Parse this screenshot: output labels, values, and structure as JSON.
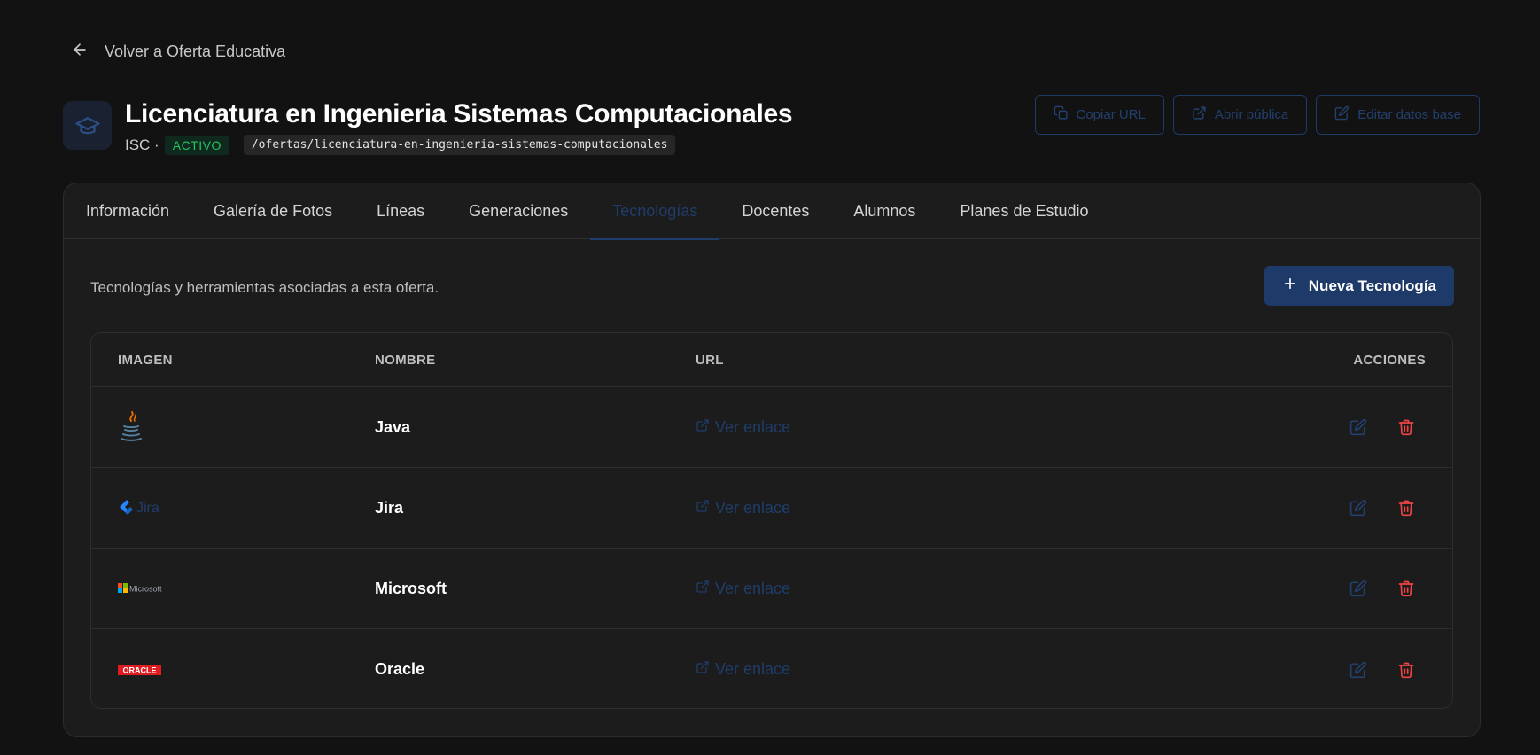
{
  "back": {
    "label": "Volver a Oferta Educativa"
  },
  "header": {
    "title": "Licenciatura en Ingenieria Sistemas Computacionales",
    "code": "ISC ·",
    "status": "ACTIVO",
    "slug": "/ofertas/licenciatura-en-ingenieria-sistemas-computacionales"
  },
  "actions": {
    "copy_url": "Copiar URL",
    "open_public": "Abrir pública",
    "edit_base": "Editar datos base"
  },
  "tabs": [
    {
      "label": "Información"
    },
    {
      "label": "Galería de Fotos"
    },
    {
      "label": "Líneas"
    },
    {
      "label": "Generaciones"
    },
    {
      "label": "Tecnologías",
      "active": true
    },
    {
      "label": "Docentes"
    },
    {
      "label": "Alumnos"
    },
    {
      "label": "Planes de Estudio"
    }
  ],
  "section": {
    "description": "Tecnologías y herramientas asociadas a esta oferta.",
    "new_button": "Nueva Tecnología"
  },
  "table": {
    "headers": {
      "image": "IMAGEN",
      "name": "NOMBRE",
      "url": "URL",
      "actions": "ACCIONES"
    },
    "rows": [
      {
        "name": "Java",
        "link": "Ver enlace",
        "logo": "java-logo"
      },
      {
        "name": "Jira",
        "link": "Ver enlace",
        "logo": "jira-logo",
        "logo_text": "Jira"
      },
      {
        "name": "Microsoft",
        "link": "Ver enlace",
        "logo": "microsoft-logo",
        "logo_text": "Microsoft"
      },
      {
        "name": "Oracle",
        "link": "Ver enlace",
        "logo": "oracle-logo",
        "logo_text": "ORACLE"
      }
    ]
  },
  "colors": {
    "background": "#121212",
    "card": "#1c1c1c",
    "accent": "#1e3a68",
    "status_green": "#22c55e",
    "delete_red": "#ef4444"
  }
}
